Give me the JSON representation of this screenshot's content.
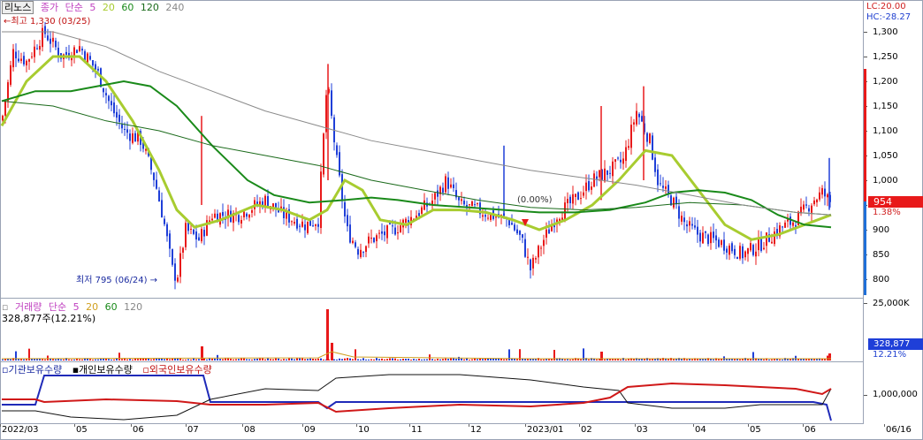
{
  "header": {
    "symbol": "리노스",
    "price_label": "종가",
    "ma_type": "단순",
    "ma_periods": [
      "5",
      "20",
      "60",
      "120",
      "240"
    ]
  },
  "colors": {
    "up": "#e8191a",
    "down": "#1f3fd8",
    "ma5": "#c040c0",
    "ma20": "#a8cc30",
    "ma60": "#1a8a1a",
    "ma120": "#1a6a1a",
    "ma240": "#8a8a8a"
  },
  "annotations": {
    "high": "최고 1,330 (03/25)",
    "low": "최저 795 (06/24)",
    "zero_pct": "(0.00%)"
  },
  "price_axis": {
    "lc": "LC:20.00",
    "hc": "HC:-28.27",
    "ticks": [
      "1,300",
      "1,250",
      "1,200",
      "1,150",
      "1,100",
      "1,050",
      "1,000",
      "950",
      "900",
      "850",
      "800"
    ],
    "current_price": "954",
    "current_change": "1.38%"
  },
  "volume_pane": {
    "title": "거래량",
    "ma_type": "단순",
    "ma_periods": [
      "5",
      "20",
      "60",
      "120"
    ],
    "current": "328,877주(12.21%)",
    "tick": "25,000K",
    "current_value": "328,877",
    "current_pct": "12.21%"
  },
  "holdings_pane": {
    "labels": [
      "기관보유수량",
      "개인보유수량",
      "외국인보유수량"
    ],
    "tick": "1,000,000"
  },
  "x_axis": {
    "labels": [
      "2022/03",
      "05",
      "06",
      "07",
      "08",
      "09",
      "10",
      "11",
      "12",
      "2023/01",
      "02",
      "03",
      "04",
      "05",
      "06",
      "06/16"
    ]
  }
}
